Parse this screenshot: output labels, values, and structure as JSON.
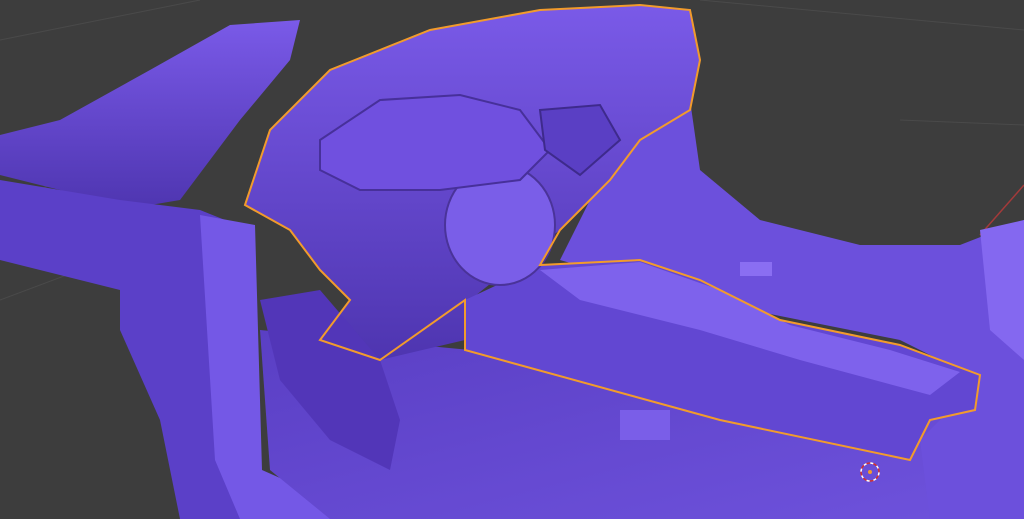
{
  "viewport": {
    "type": "3d-viewport",
    "colors": {
      "background": "#3d3d3d",
      "grid": "#4a4a4a",
      "axis_x": "#a33a3a",
      "model": "#6a4bd8",
      "model_light": "#8a6af0",
      "model_dark": "#3e2a8c",
      "selection_outline": "#f29b2c"
    },
    "icons": {
      "cursor": "3d-cursor-icon"
    }
  }
}
